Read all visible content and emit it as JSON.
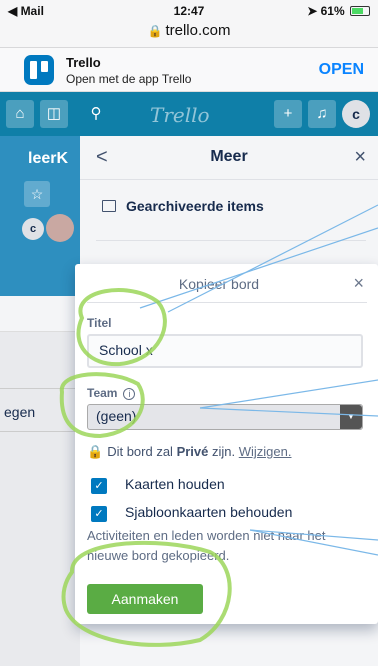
{
  "status_bar": {
    "carrier": "◀ Mail",
    "time": "12:47",
    "battery_text": "61%",
    "location_icon": "location-arrow-icon"
  },
  "browser": {
    "url": "trello.com"
  },
  "app_banner": {
    "name": "Trello",
    "subtitle": "Open met de app Trello",
    "open_label": "OPEN"
  },
  "header": {
    "logo": "Trello",
    "avatar_initial": "c",
    "icons": [
      "home-icon",
      "boards-icon",
      "search-icon",
      "plus-icon",
      "bell-icon"
    ]
  },
  "board": {
    "title_fragment": "leerK",
    "member_initial": "c",
    "side_label": "egen"
  },
  "meer_panel": {
    "back": "<",
    "title": "Meer",
    "close": "×",
    "archived_label": "Gearchiveerde items"
  },
  "copy_board": {
    "title": "Kopieer bord",
    "close": "×",
    "title_label": "Titel",
    "title_value": "School x",
    "team_label": "Team",
    "team_value": "(geen)",
    "privacy_prefix": "Dit bord zal",
    "privacy_level": "Privé",
    "privacy_suffix": "zijn.",
    "change_link": "Wijzigen.",
    "keep_cards_label": "Kaarten houden",
    "keep_templates_label": "Sjabloonkaarten behouden",
    "note": "Activiteiten en leden worden niet naar het nieuwe bord gekopieerd.",
    "create_button": "Aanmaken"
  },
  "colors": {
    "header_blue": "#0f7fa8",
    "create_green": "#5aac44",
    "checkbox_blue": "#0079bf",
    "annotation_green": "#9cd65a",
    "annotation_line_blue": "#7bb8e8"
  }
}
